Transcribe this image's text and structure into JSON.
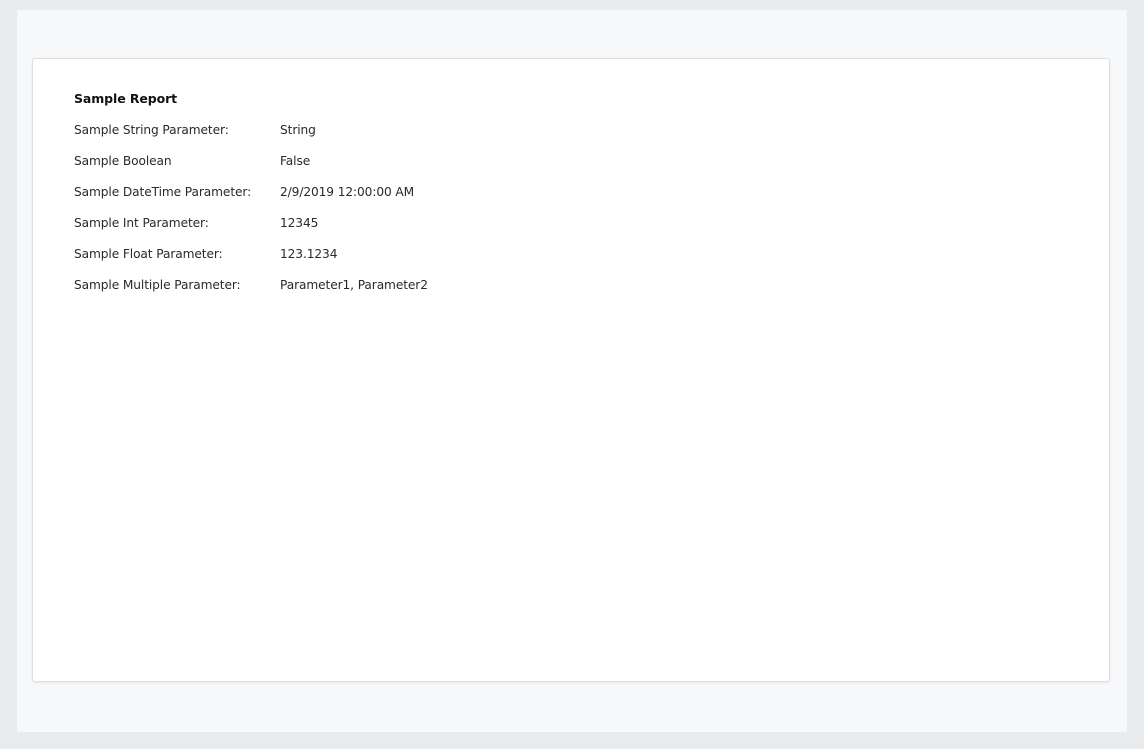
{
  "report": {
    "title": "Sample Report",
    "parameters": [
      {
        "label": "Sample String Parameter:",
        "value": "String"
      },
      {
        "label": "Sample Boolean",
        "value": "False"
      },
      {
        "label": "Sample DateTime Parameter:",
        "value": "2/9/2019 12:00:00 AM"
      },
      {
        "label": "Sample Int Parameter:",
        "value": "12345"
      },
      {
        "label": "Sample Float Parameter:",
        "value": "123.1234"
      },
      {
        "label": "Sample Multiple Parameter:",
        "value": "Parameter1, Parameter2"
      }
    ]
  },
  "colors": {
    "background": "#e9ecef",
    "frame": "#f7f8fa",
    "page": "#ffffff",
    "border": "#dcdfe3"
  }
}
